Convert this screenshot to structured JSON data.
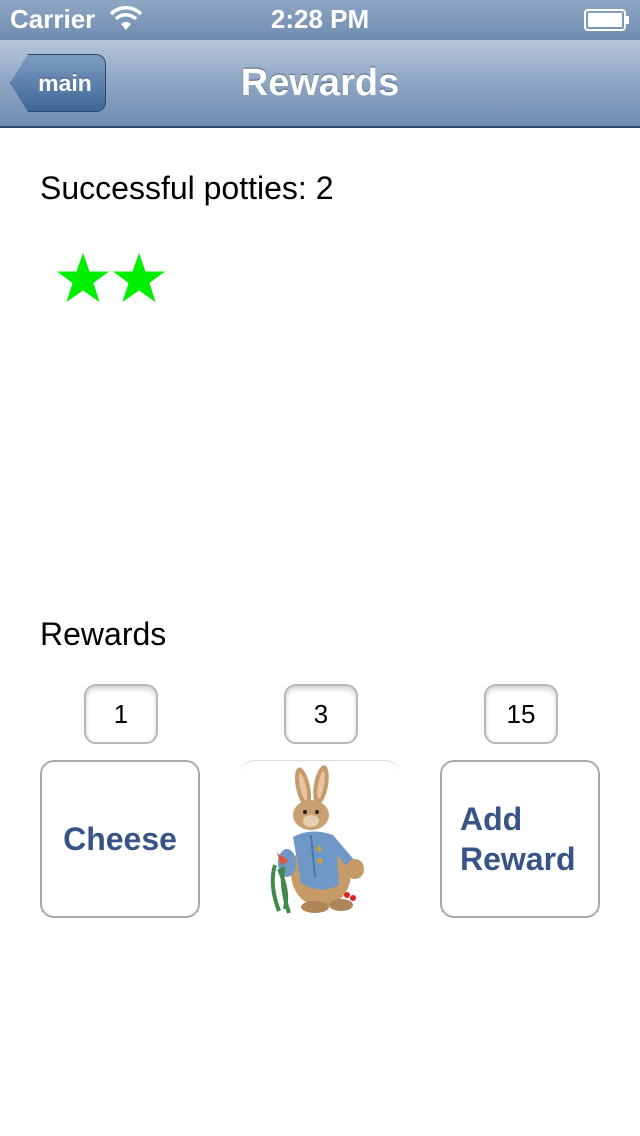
{
  "status_bar": {
    "carrier": "Carrier",
    "time": "2:28 PM"
  },
  "nav": {
    "back_label": "main",
    "title": "Rewards"
  },
  "potties": {
    "label": "Successful potties: 2",
    "star_count": 2,
    "star_color": "#00ee00"
  },
  "rewards": {
    "label": "Rewards",
    "items": [
      {
        "count": "1",
        "label": "Cheese"
      },
      {
        "count": "3",
        "label": "",
        "image": "stuffed-bunny-toy"
      },
      {
        "count": "15",
        "label": "Add Reward"
      }
    ]
  },
  "colors": {
    "nav_blue": "#6f8db1",
    "button_text": "#385487"
  }
}
